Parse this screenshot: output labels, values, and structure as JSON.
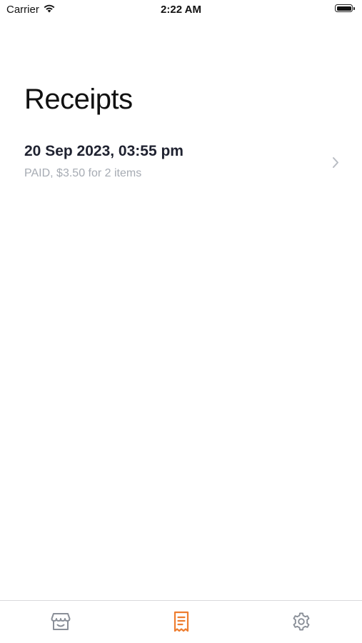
{
  "status_bar": {
    "carrier": "Carrier",
    "time": "2:22 AM",
    "battery_level": 1.0
  },
  "page": {
    "title": "Receipts"
  },
  "receipts": [
    {
      "date": "20 Sep 2023, 03:55 pm",
      "summary": "PAID, $3.50 for 2 items"
    }
  ],
  "tab_bar": {
    "tabs": [
      {
        "icon": "store-icon",
        "active": false
      },
      {
        "icon": "receipt-icon",
        "active": true
      },
      {
        "icon": "gear-icon",
        "active": false
      }
    ]
  },
  "colors": {
    "accent": "#ee7d2f",
    "inactive_icon": "#8a8f98",
    "secondary_text": "#a6abb3",
    "chevron": "#b8bcc3"
  }
}
